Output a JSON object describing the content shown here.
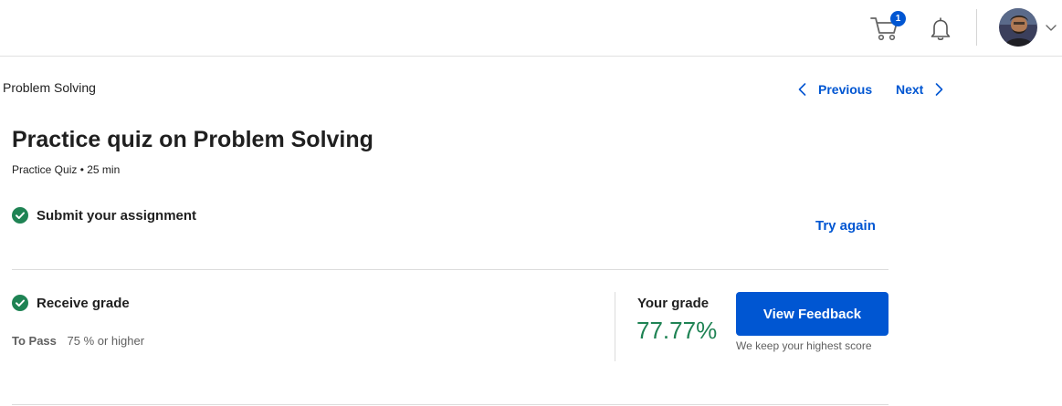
{
  "header": {
    "cart_count": "1",
    "icons": [
      "cart-icon",
      "bell-icon",
      "avatar",
      "chevron-down-icon"
    ]
  },
  "breadcrumb": "Problem Solving",
  "nav": {
    "previous_label": "Previous",
    "next_label": "Next"
  },
  "quiz": {
    "title": "Practice quiz on Problem Solving",
    "meta": "Practice Quiz • 25 min"
  },
  "steps": {
    "submit_label": "Submit your assignment",
    "try_again_label": "Try again",
    "receive_label": "Receive grade",
    "to_pass_label": "To Pass",
    "to_pass_value": "75 % or higher"
  },
  "grade": {
    "label": "Your grade",
    "value": "77.77%",
    "button_label": "View Feedback",
    "note": "We keep your highest score"
  },
  "colors": {
    "primary": "#0056d2",
    "success": "#1f8354",
    "text": "#1f1f1f",
    "muted": "#5f5f5f"
  }
}
